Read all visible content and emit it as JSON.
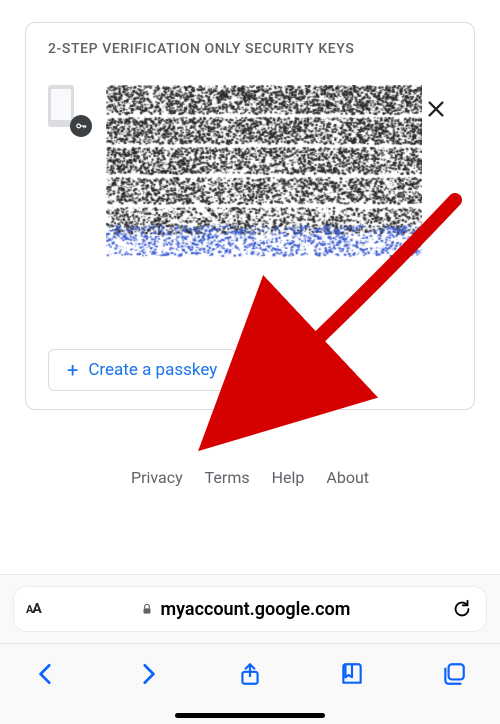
{
  "card": {
    "title": "2-STEP VERIFICATION ONLY SECURITY KEYS",
    "create_label": "Create a passkey"
  },
  "footer": {
    "privacy": "Privacy",
    "terms": "Terms",
    "help": "Help",
    "about": "About"
  },
  "browser": {
    "host": "myaccount.google.com"
  },
  "icons": {
    "phone_key": "phone-key-icon",
    "close": "close-icon",
    "plus": "plus-icon",
    "text_size": "text-size-icon",
    "lock": "lock-icon",
    "refresh": "refresh-icon",
    "nav_back": "back-icon",
    "nav_forward": "forward-icon",
    "share": "share-icon",
    "bookmarks": "bookmarks-icon",
    "tabs": "tabs-icon"
  },
  "colors": {
    "accent_blue": "#1a73e8",
    "ios_blue": "#0b63ff",
    "muted": "#5f6368",
    "border": "#dadce0"
  }
}
